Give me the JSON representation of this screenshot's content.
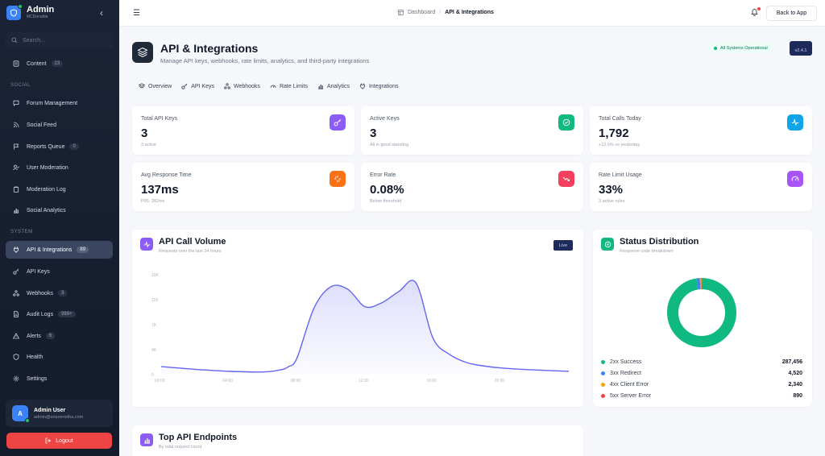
{
  "brand": {
    "title": "Admin",
    "subtitle": "MCDonalda"
  },
  "search": {
    "placeholder": "Search..."
  },
  "nav": {
    "content": {
      "label": "Content",
      "badge": "23"
    },
    "social_label": "SOCIAL",
    "social": [
      {
        "label": "Forum Management",
        "badge": ""
      },
      {
        "label": "Social Feed",
        "badge": ""
      },
      {
        "label": "Reports Queue",
        "badge": "0"
      },
      {
        "label": "User Moderation",
        "badge": ""
      },
      {
        "label": "Moderation Log",
        "badge": ""
      },
      {
        "label": "Social Analytics",
        "badge": ""
      }
    ],
    "system_label": "SYSTEM",
    "system": [
      {
        "label": "API & Integrations",
        "badge": "89",
        "active": true
      },
      {
        "label": "API Keys",
        "badge": ""
      },
      {
        "label": "Webhooks",
        "badge": "3"
      },
      {
        "label": "Audit Logs",
        "badge": "999+"
      },
      {
        "label": "Alerts",
        "badge": "6"
      },
      {
        "label": "Health",
        "badge": ""
      },
      {
        "label": "Settings",
        "badge": ""
      }
    ]
  },
  "user": {
    "initial": "A",
    "name": "Admin User",
    "email": "admin@enszerodha.com"
  },
  "logout_label": "Logout",
  "breadcrumb": {
    "root": "Dashboard",
    "separator": "/",
    "current": "API & Integrations"
  },
  "back_label": "Back to App",
  "page": {
    "title": "API & Integrations",
    "subtitle": "Manage API keys, webhooks, rate limits, analytics, and third-party integrations",
    "status": "All Systems Operational",
    "version": "v2.4.1"
  },
  "tabs": [
    "Overview",
    "API Keys",
    "Webhooks",
    "Rate Limits",
    "Analytics",
    "Integrations"
  ],
  "stats": [
    {
      "label": "Total API Keys",
      "value": "3",
      "foot": "3 active",
      "color": "#8b5cf6"
    },
    {
      "label": "Active Keys",
      "value": "3",
      "foot": "All in good standing",
      "color": "#10b981"
    },
    {
      "label": "Total Calls Today",
      "value": "1,792",
      "foot": "+12.5% vs yesterday",
      "color": "#0ea5e9"
    },
    {
      "label": "Avg Response Time",
      "value": "137ms",
      "foot": "P95: 282ms",
      "color": "#f97316"
    },
    {
      "label": "Error Rate",
      "value": "0.08%",
      "foot": "Below threshold",
      "color": "#f43f5e"
    },
    {
      "label": "Rate Limit Usage",
      "value": "33%",
      "foot": "3 active rules",
      "color": "#a855f7"
    }
  ],
  "volume_panel": {
    "title": "API Call Volume",
    "subtitle": "Requests over the last 24 hours",
    "live": "Live"
  },
  "status_panel": {
    "title": "Status Distribution",
    "subtitle": "Response code breakdown"
  },
  "endpoints_panel": {
    "title": "Top API Endpoints",
    "subtitle": "By total request count"
  },
  "chart_data": [
    {
      "type": "area",
      "title": "API Call Volume",
      "x_ticks": [
        "00:00",
        "04:00",
        "08:00",
        "12:00",
        "16:00",
        "20:00"
      ],
      "y_ticks": [
        "0",
        "4K",
        "7K",
        "11K",
        "15K"
      ],
      "ylim": [
        0,
        15000
      ],
      "x": [
        0,
        2,
        4,
        6,
        7,
        7.5,
        8,
        9,
        10,
        11,
        12,
        13,
        14,
        15,
        16,
        17,
        18,
        19,
        20,
        22,
        24
      ],
      "values": [
        1200,
        800,
        500,
        400,
        700,
        1200,
        2500,
        10000,
        13200,
        12800,
        10200,
        10800,
        12500,
        13800,
        5500,
        3000,
        1800,
        1300,
        1000,
        700,
        500
      ]
    },
    {
      "type": "pie",
      "title": "Status Distribution",
      "categories": [
        "2xx Success",
        "3xx Redirect",
        "4xx Client Error",
        "5xx Server Error"
      ],
      "values": [
        287456,
        4520,
        2340,
        890
      ],
      "display_values": [
        "287,456",
        "4,520",
        "2,340",
        "890"
      ],
      "colors": [
        "#10b981",
        "#3b82f6",
        "#f59e0b",
        "#ef4444"
      ]
    }
  ]
}
